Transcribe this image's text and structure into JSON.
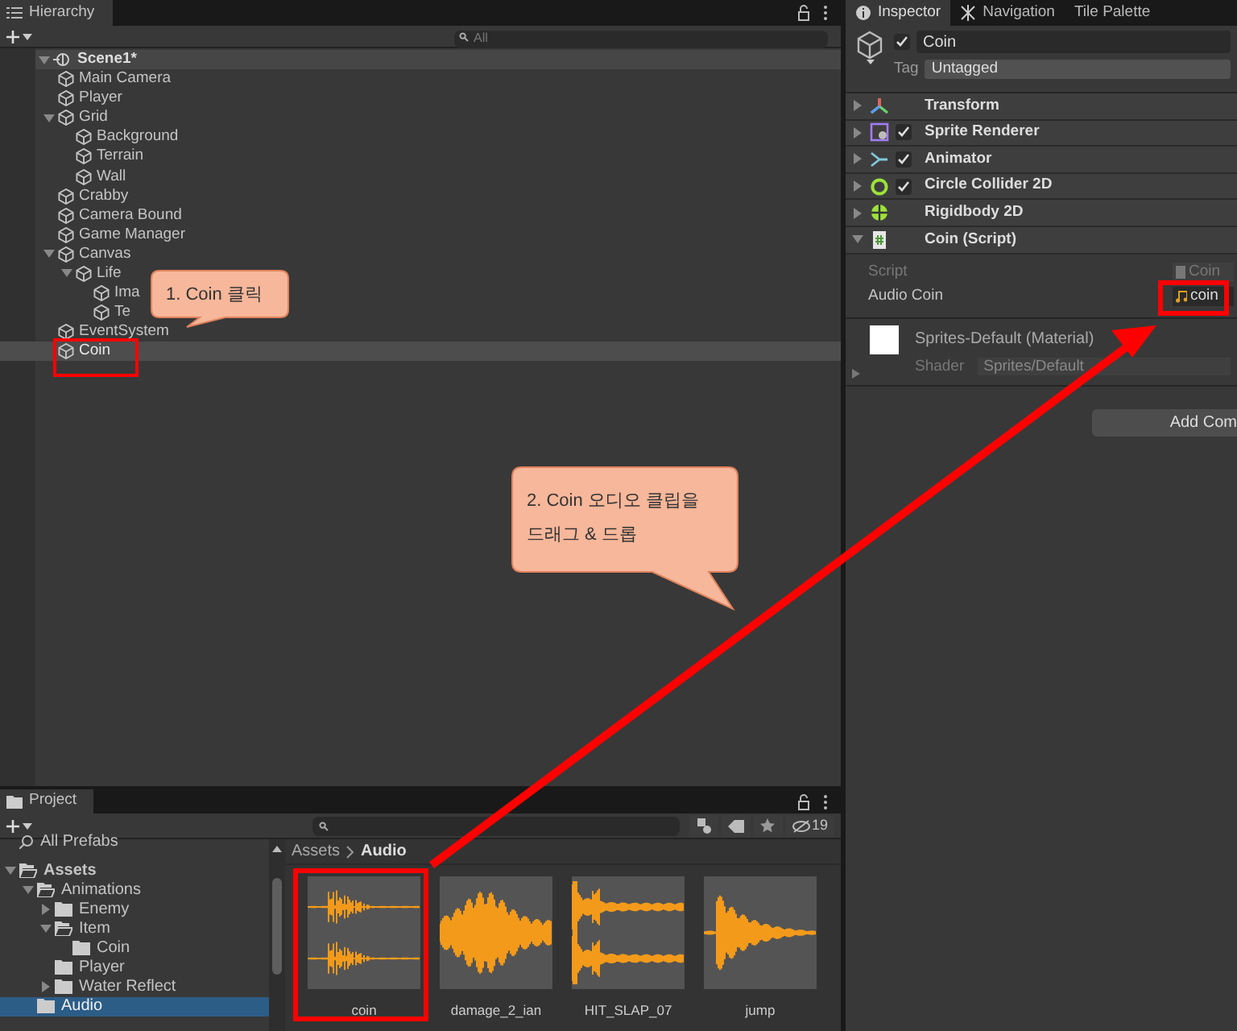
{
  "hierarchy": {
    "tab": "Hierarchy",
    "search_placeholder": "All",
    "scene": {
      "label": "Scene1*",
      "expanded": true,
      "children": [
        {
          "label": "Main Camera",
          "selected": false
        },
        {
          "label": "Player",
          "selected": false
        },
        {
          "label": "Grid",
          "selected": false,
          "expanded": true,
          "children": [
            {
              "label": "Background",
              "selected": false
            },
            {
              "label": "Terrain",
              "selected": false
            },
            {
              "label": "Wall",
              "selected": false
            }
          ]
        },
        {
          "label": "Crabby",
          "selected": false
        },
        {
          "label": "Camera Bound",
          "selected": false
        },
        {
          "label": "Game Manager",
          "selected": false
        },
        {
          "label": "Canvas",
          "selected": false,
          "expanded": true,
          "children": [
            {
              "label": "Life",
              "selected": false,
              "expanded": true,
              "children": [
                {
                  "label": "Ima",
                  "selected": false
                },
                {
                  "label": "Te",
                  "selected": false
                }
              ]
            }
          ]
        },
        {
          "label": "EventSystem",
          "selected": false
        },
        {
          "label": "Coin",
          "selected": true
        }
      ]
    }
  },
  "inspector": {
    "tabs": [
      {
        "label": "Inspector",
        "selected": true
      },
      {
        "label": "Navigation",
        "selected": false
      },
      {
        "label": "Tile Palette",
        "selected": false
      }
    ],
    "object": {
      "name": "Coin",
      "active": true,
      "tag_label": "Tag",
      "tag": "Untagged"
    },
    "components": [
      {
        "kind": "transform",
        "name": "Transform",
        "expanded": false
      },
      {
        "kind": "sprite",
        "name": "Sprite Renderer",
        "checked": true,
        "expanded": false
      },
      {
        "kind": "animator",
        "name": "Animator",
        "checked": true,
        "expanded": false
      },
      {
        "kind": "collider",
        "name": "Circle Collider 2D",
        "checked": true,
        "expanded": false
      },
      {
        "kind": "rigidbody",
        "name": "Rigidbody 2D",
        "expanded": false
      },
      {
        "kind": "script",
        "name": "Coin (Script)",
        "expanded": true
      }
    ],
    "fields": [
      {
        "kind": "script",
        "label": "Script",
        "value": "Coin",
        "disabled": true
      },
      {
        "kind": "audio",
        "label": "Audio Coin",
        "value": "coin",
        "disabled": false
      }
    ],
    "material": {
      "name": "Sprites-Default (Material)",
      "shader_label": "Shader",
      "shader": "Sprites/Default"
    },
    "add_button": "Add Com"
  },
  "project": {
    "tab": "Project",
    "hidden_count": "19",
    "tree": [
      {
        "kind": "search",
        "label": "All Prefabs",
        "selected": false
      },
      {
        "kind": "folder",
        "label": "Assets",
        "selected": false,
        "expanded": true,
        "children": [
          {
            "kind": "folder",
            "label": "Animations",
            "selected": false,
            "expanded": true,
            "children": [
              {
                "kind": "folder",
                "label": "Enemy",
                "selected": false,
                "expanded": false
              },
              {
                "kind": "folder",
                "label": "Item",
                "selected": false,
                "expanded": true,
                "children": [
                  {
                    "kind": "folder",
                    "label": "Coin",
                    "selected": false
                  }
                ]
              },
              {
                "kind": "folder",
                "label": "Player",
                "selected": false
              },
              {
                "kind": "folder",
                "label": "Water Reflect",
                "selected": false,
                "expanded": false
              }
            ]
          },
          {
            "kind": "folder",
            "label": "Audio",
            "selected": true
          }
        ]
      }
    ],
    "breadcrumb": [
      "Assets",
      "Audio"
    ],
    "assets": [
      {
        "name": "coin",
        "kind": "stereo"
      },
      {
        "name": "damage_2_ian",
        "kind": "mono"
      },
      {
        "name": "HIT_SLAP_07",
        "kind": "stereo"
      },
      {
        "name": "jump",
        "kind": "mono"
      }
    ]
  },
  "callouts": [
    {
      "text": "1. Coin 클릭"
    },
    {
      "text": "2. Coin 오디오 클립을 드래그 & 드롭"
    }
  ]
}
